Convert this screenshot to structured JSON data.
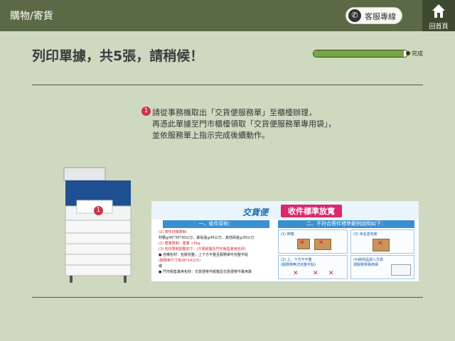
{
  "header": {
    "title": "購物/寄貨",
    "service_label": "客服專線",
    "home_label": "回首頁"
  },
  "main": {
    "heading": "列印單據，共5張，請稍候！",
    "progress": {
      "value": 0.96,
      "label": "完成"
    },
    "instruction": {
      "number": "1",
      "line1": "請從事務機取出「交貨便服務單」至櫃檯辦理，",
      "line2": "再憑此單據至門市櫃檯領取「交貨便服務單專用袋」，",
      "line3": "並依服務單上指示完成後續動作。"
    },
    "printer_marker": "1",
    "poster": {
      "brand": "交貨便",
      "title": "收件標準放寬",
      "section1": "一、收件原則：",
      "section2": "二、不符合寄件標準範例說明如下：",
      "rule1": "(1) 寄件材積限制：",
      "rule1a": "材積≦45*30*30公分，最長邊≦45公分，其他兩邊≦30公分",
      "rule2": "(2) 重量限制：重量 <5kg",
      "rule3": "(3) 包材限制調整如下：(不限紙箱及門市販售專用包材)",
      "rule3a": "● 自備包材：包裝完整，上下方平整且服務單可完整平貼",
      "rule3b": "(服務單尺寸為26*14公分)",
      "rule3c": "或",
      "rule3d": "● 門市販售專用包材：交貨便寄件紙箱及交貨便寄件專用袋",
      "ex1": "(1) 倒箱",
      "ex2": "(3) 未妥善包裝",
      "ex3": "(2) 上、下方不平整",
      "ex3b": "(服務單無法完整平貼)",
      "ex4": "(4)將商品放入交貨便服務單專用袋"
    }
  },
  "colors": {
    "background": "#cfd9c0",
    "topbar": "#5b6a46",
    "accent_green": "#77a543",
    "marker_red": "#cc3344"
  }
}
